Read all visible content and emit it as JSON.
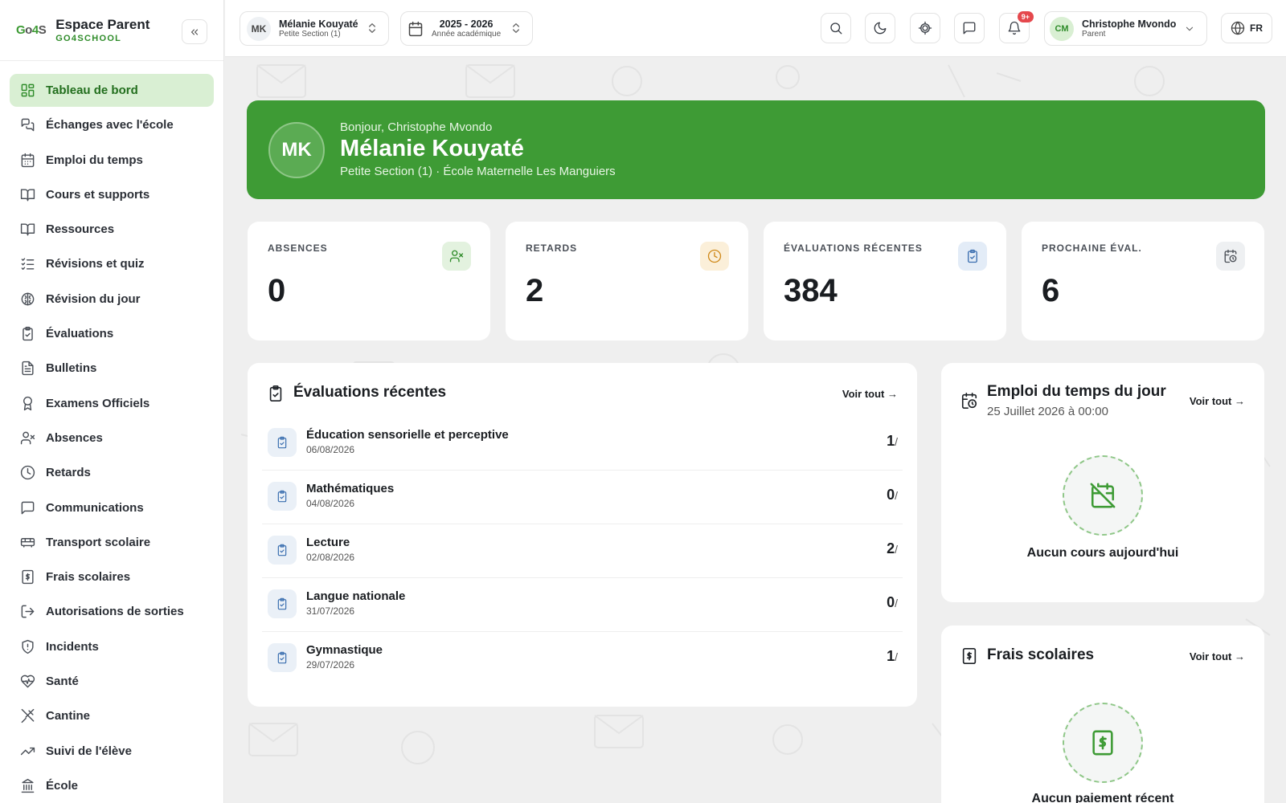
{
  "brand": {
    "logo": "Go4S",
    "title": "Espace Parent",
    "subtitle": "GO4SCHOOL"
  },
  "sidebar": {
    "items": [
      {
        "label": "Tableau de bord",
        "icon": "dashboard-icon"
      },
      {
        "label": "Échanges avec l'école",
        "icon": "chat-bubbles-icon"
      },
      {
        "label": "Emploi du temps",
        "icon": "calendar-icon"
      },
      {
        "label": "Cours et supports",
        "icon": "book-open-icon"
      },
      {
        "label": "Ressources",
        "icon": "book-open-icon"
      },
      {
        "label": "Révisions et quiz",
        "icon": "list-check-icon"
      },
      {
        "label": "Révision du jour",
        "icon": "brain-icon"
      },
      {
        "label": "Évaluations",
        "icon": "clipboard-check-icon"
      },
      {
        "label": "Bulletins",
        "icon": "file-text-icon"
      },
      {
        "label": "Examens Officiels",
        "icon": "award-icon"
      },
      {
        "label": "Absences",
        "icon": "user-x-icon"
      },
      {
        "label": "Retards",
        "icon": "clock-icon"
      },
      {
        "label": "Communications",
        "icon": "message-square-icon"
      },
      {
        "label": "Transport scolaire",
        "icon": "bus-icon"
      },
      {
        "label": "Frais scolaires",
        "icon": "receipt-dollar-icon"
      },
      {
        "label": "Autorisations de sorties",
        "icon": "log-out-icon"
      },
      {
        "label": "Incidents",
        "icon": "shield-alert-icon"
      },
      {
        "label": "Santé",
        "icon": "heart-pulse-icon"
      },
      {
        "label": "Cantine",
        "icon": "utensils-icon"
      },
      {
        "label": "Suivi de l'élève",
        "icon": "trending-up-icon"
      },
      {
        "label": "École",
        "icon": "building-icon"
      }
    ]
  },
  "topbar": {
    "student": {
      "initials": "MK",
      "name": "Mélanie Kouyaté",
      "class": "Petite Section (1)"
    },
    "year": {
      "value": "2025 - 2026",
      "label": "Année académique"
    },
    "notifications_badge": "9+",
    "user": {
      "initials": "CM",
      "name": "Christophe Mvondo",
      "role": "Parent"
    },
    "language": "FR"
  },
  "hero": {
    "initials": "MK",
    "greeting": "Bonjour, Christophe Mvondo",
    "name": "Mélanie Kouyaté",
    "subtitle": "Petite Section (1) · École Maternelle Les Manguiers"
  },
  "stats": [
    {
      "label": "ABSENCES",
      "value": "0",
      "icon": "user-x-icon",
      "color": "#2f8c2a",
      "bg": "#e3f2df"
    },
    {
      "label": "RETARDS",
      "value": "2",
      "icon": "clock-icon",
      "color": "#d08a1b",
      "bg": "#fbefd9"
    },
    {
      "label": "ÉVALUATIONS RÉCENTES",
      "value": "384",
      "icon": "clipboard-check-icon",
      "color": "#3b6fb0",
      "bg": "#e3ecf7"
    },
    {
      "label": "PROCHAINE ÉVAL.",
      "value": "6",
      "icon": "calendar-clock-icon",
      "color": "#4a4f57",
      "bg": "#eef0f2"
    }
  ],
  "evaluations": {
    "title": "Évaluations récentes",
    "see_all": "Voir tout →",
    "rows": [
      {
        "subject": "Éducation sensorielle et perceptive",
        "date": "06/08/2026",
        "score": "1",
        "suffix": "/"
      },
      {
        "subject": "Mathématiques",
        "date": "04/08/2026",
        "score": "0",
        "suffix": "/"
      },
      {
        "subject": "Lecture",
        "date": "02/08/2026",
        "score": "2",
        "suffix": "/"
      },
      {
        "subject": "Langue nationale",
        "date": "31/07/2026",
        "score": "0",
        "suffix": "/"
      },
      {
        "subject": "Gymnastique",
        "date": "29/07/2026",
        "score": "1",
        "suffix": "/"
      }
    ]
  },
  "schedule": {
    "title": "Emploi du temps du jour",
    "subtitle": "25 Juillet 2026 à 00:00",
    "see_all": "Voir tout →",
    "empty": "Aucun cours aujourd'hui"
  },
  "fees": {
    "title": "Frais scolaires",
    "see_all": "Voir tout →",
    "empty": "Aucun paiement récent"
  }
}
